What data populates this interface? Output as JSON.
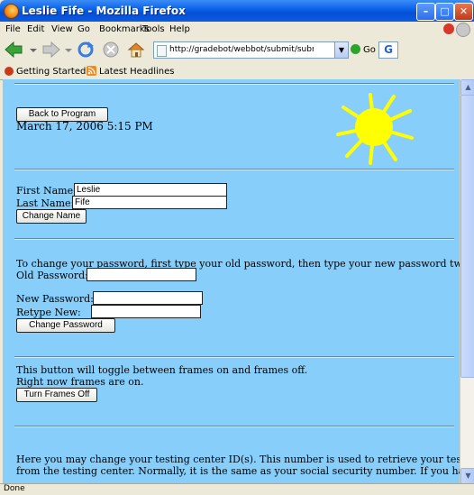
{
  "window": {
    "title": "Leslie Fife - Mozilla Firefox"
  },
  "menu": {
    "file": "File",
    "edit": "Edit",
    "view": "View",
    "go": "Go",
    "bookmarks": "Bookmarks",
    "tools": "Tools",
    "help": "Help"
  },
  "nav": {
    "url": "http://gradebot/webbot/submit/submit.cg",
    "go_label": "Go",
    "search_engine": "G"
  },
  "bookmarks_bar": {
    "item1": "Getting Started",
    "item2": "Latest Headlines"
  },
  "page": {
    "back_button": "Back to Program",
    "date": "March 17,  2006    5:15 PM",
    "first_name_label": "First Name:",
    "first_name_value": "Leslie",
    "last_name_label": "Last Name:",
    "last_name_value": "Fife",
    "change_name_button": "Change Name",
    "password_intro": "To change your password, first type your old password, then type your new password twice.",
    "old_password_label": "Old Password:",
    "new_password_label": "New Password:",
    "retype_label": "Retype New:",
    "change_password_button": "Change Password",
    "frames_line1": "This button will toggle between frames on and frames off.",
    "frames_line2": "Right now frames are on.",
    "frames_button": "Turn Frames  Off",
    "testing_line1": "Here you may change your testing center ID(s). This number is used to retrieve your test scores",
    "testing_line2": "from the testing center. Normally, it is the same as your social security number. If you have more"
  },
  "status": {
    "text": "Done"
  },
  "colors": {
    "page_bg": "#87cefa",
    "titlebar": "#0a5fe8",
    "sun": "#ffff00"
  }
}
